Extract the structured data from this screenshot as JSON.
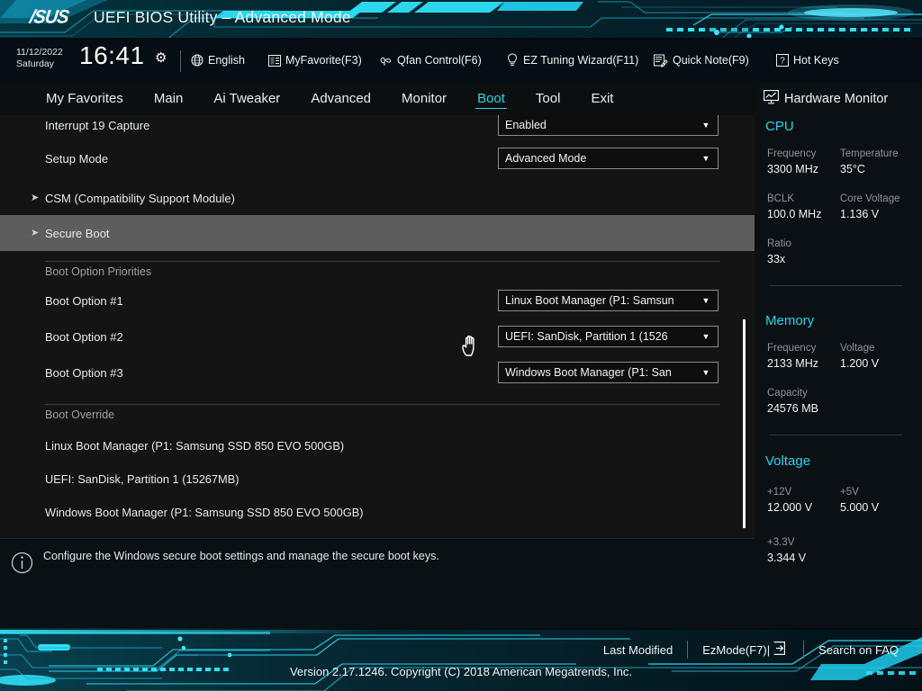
{
  "header": {
    "logo": "/SUS",
    "logo_name": "asus-logo",
    "title": "UEFI BIOS Utility – Advanced Mode"
  },
  "infobar": {
    "date": "11/12/2022",
    "weekday": "Saturday",
    "time": "16:41",
    "gear_icon": "gear-icon",
    "items": [
      {
        "label": "English",
        "icon": "globe-icon"
      },
      {
        "label": "MyFavorite(F3)",
        "icon": "list-icon"
      },
      {
        "label": "Qfan Control(F6)",
        "icon": "fan-icon"
      },
      {
        "label": "EZ Tuning Wizard(F11)",
        "icon": "bulb-icon"
      },
      {
        "label": "Quick Note(F9)",
        "icon": "note-icon"
      },
      {
        "label": "Hot Keys",
        "icon": "question-box-icon"
      }
    ]
  },
  "nav": {
    "tabs": [
      {
        "label": "My Favorites",
        "active": false
      },
      {
        "label": "Main",
        "active": false
      },
      {
        "label": "Ai Tweaker",
        "active": false
      },
      {
        "label": "Advanced",
        "active": false
      },
      {
        "label": "Monitor",
        "active": false
      },
      {
        "label": "Boot",
        "active": true
      },
      {
        "label": "Tool",
        "active": false
      },
      {
        "label": "Exit",
        "active": false
      }
    ]
  },
  "content": {
    "settings": [
      {
        "label": "Interrupt 19 Capture",
        "value": "Enabled"
      },
      {
        "label": "Setup Mode",
        "value": "Advanced Mode"
      }
    ],
    "submenus": [
      {
        "label": "CSM (Compatibility Support Module)",
        "highlighted": false
      },
      {
        "label": "Secure Boot",
        "highlighted": true
      }
    ],
    "priorities_heading": "Boot Option Priorities",
    "priorities": [
      {
        "label": "Boot Option #1",
        "value": "Linux Boot Manager (P1: Samsun"
      },
      {
        "label": "Boot Option #2",
        "value": "UEFI: SanDisk, Partition 1 (1526"
      },
      {
        "label": "Boot Option #3",
        "value": "Windows Boot Manager (P1: San"
      }
    ],
    "override_heading": "Boot Override",
    "override_items": [
      "Linux Boot Manager (P1: Samsung SSD 850 EVO 500GB)",
      "UEFI: SanDisk, Partition 1 (15267MB)",
      "Windows Boot Manager (P1: Samsung SSD 850 EVO 500GB)"
    ]
  },
  "help": {
    "icon": "info-icon",
    "text": "Configure the Windows secure boot settings and manage the secure boot keys."
  },
  "sidebar": {
    "title": "Hardware Monitor",
    "title_icon": "monitor-icon",
    "groups": [
      {
        "name": "CPU",
        "rows": [
          [
            {
              "key": "Frequency",
              "value": "3300 MHz"
            },
            {
              "key": "Temperature",
              "value": "35°C"
            }
          ],
          [
            {
              "key": "BCLK",
              "value": "100.0 MHz"
            },
            {
              "key": "Core Voltage",
              "value": "1.136 V"
            }
          ],
          [
            {
              "key": "Ratio",
              "value": "33x"
            }
          ]
        ]
      },
      {
        "name": "Memory",
        "rows": [
          [
            {
              "key": "Frequency",
              "value": "2133 MHz"
            },
            {
              "key": "Voltage",
              "value": "1.200 V"
            }
          ],
          [
            {
              "key": "Capacity",
              "value": "24576 MB"
            }
          ]
        ]
      },
      {
        "name": "Voltage",
        "rows": [
          [
            {
              "key": "+12V",
              "value": "12.000 V"
            },
            {
              "key": "+5V",
              "value": "5.000 V"
            }
          ],
          [
            {
              "key": "+3.3V",
              "value": "3.344 V"
            }
          ]
        ]
      }
    ]
  },
  "footer": {
    "links": [
      {
        "label": "Last Modified",
        "icon": null
      },
      {
        "label": "EzMode(F7)|",
        "icon": "arrow-right-box-icon"
      },
      {
        "label": "Search on FAQ",
        "icon": null
      }
    ],
    "version": "Version 2.17.1246. Copyright (C) 2018 American Megatrends, Inc."
  },
  "colors": {
    "accent": "#2ad3ef",
    "panel": "#141414",
    "highlight": "#5d5d5d"
  }
}
